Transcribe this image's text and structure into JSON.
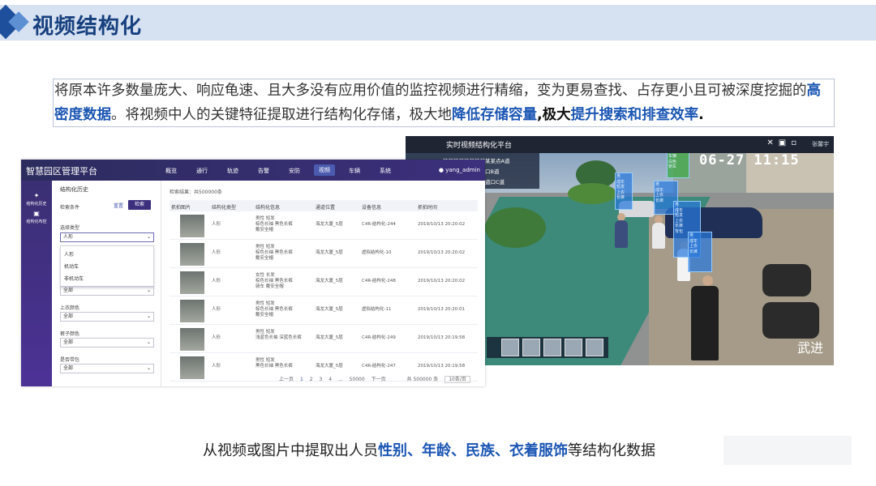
{
  "slide": {
    "title": "视频结构化",
    "paragraph": {
      "p1": "将原本许多数量庞大、响应龟速、且大多没有应用价值的监控视频进行精缩，变为更易查找、占存更小且可被深度挖掘的",
      "hl1": "高密度数据",
      "p2": "。将视频中人的关键特征提取进行结构化存储，",
      "p3": "极大地",
      "hl2": "降低存储容量",
      "p4": ",极大",
      "hl3": "提升搜索和排查效率",
      "p5": "."
    },
    "caption": {
      "prefix": "从视频或图片中提取出人员",
      "h1": "性别",
      "s1": "、",
      "h2": "年龄",
      "s2": "、",
      "h3": "民族",
      "s3": "、",
      "h4": "衣着服饰",
      "suffix": "等结构化数据"
    },
    "accent_color": "#1b56b3",
    "title_color": "#17407f"
  },
  "video_panel": {
    "title": "实时视频结构化平台",
    "user": "张馨宇",
    "timestamp": "06-27 11:15",
    "watermark": "武进",
    "channels": [
      "某某某某某某某某某某点A道",
      "某某某某某某某某口B道",
      "某某某某某某某某道口C道"
    ]
  },
  "app": {
    "title": "智慧园区管理平台",
    "nav": [
      "概览",
      "通行",
      "轨迹",
      "告警",
      "安防",
      "视频",
      "车辆",
      "系统"
    ],
    "active_nav": "视频",
    "user": "yang_admin",
    "sidebar": [
      {
        "label": "结构化历史",
        "icon": "history-icon"
      },
      {
        "label": "结构化布控",
        "icon": "control-icon"
      }
    ],
    "filter": {
      "title": "结构化历史",
      "condition_label": "检索条件",
      "reset_label": "重置",
      "search_label": "检索",
      "type_label": "选择类型",
      "type_value": "人形",
      "type_options": [
        "人形",
        "机动车",
        "非机动车"
      ],
      "hidden_select_value": "全部",
      "top_color_label": "上衣颜色",
      "top_color_value": "全部",
      "pants_color_label": "裤子颜色",
      "pants_color_value": "全部",
      "bag_label": "是否带包",
      "bag_value": "全部"
    },
    "results": {
      "info": "检索结果：共500000条",
      "columns": [
        "抓拍图片",
        "结构化类型",
        "结构化信息",
        "通道位置",
        "设备信息",
        "抓拍时间"
      ],
      "rows": [
        {
          "type": "人形",
          "info": [
            "男性 短发",
            "棕色长袖 黑色长裤",
            "戴安全帽"
          ],
          "location": "海龙大厦_5层",
          "device": "C4R-结构化-244",
          "time": "2019/10/13 20:20:02"
        },
        {
          "type": "人形",
          "info": [
            "男性 短发",
            "棕色长袖 黑色长裤",
            "戴安全帽"
          ],
          "location": "海龙大厦_5层",
          "device": "虚拟结构化-10",
          "time": "2019/10/13 20:20:02"
        },
        {
          "type": "人形",
          "info": [
            "女性 长发",
            "棕色长袖 黑色长裤",
            "骑车 戴安全帽"
          ],
          "location": "海龙大厦_5层",
          "device": "C4R-结构化-248",
          "time": "2019/10/13 20:20:02"
        },
        {
          "type": "人形",
          "info": [
            "男性 短发",
            "棕色长袖 黑色长裤",
            "戴安全帽"
          ],
          "location": "海龙大厦_5层",
          "device": "虚拟结构化-11",
          "time": "2019/10/13 20:20:01"
        },
        {
          "type": "人形",
          "info": [
            "男性 短发",
            "浅蓝色长袖 深蓝色长裤"
          ],
          "location": "海龙大厦_5层",
          "device": "C4R-结构化-249",
          "time": "2019/10/13 20:19:58"
        },
        {
          "type": "人形",
          "info": [
            "男性 短发",
            "黑色长袖 黑色长裤"
          ],
          "location": "海龙大厦_5层",
          "device": "C4R-结构化-247",
          "time": "2019/10/13 20:19:58"
        }
      ]
    },
    "pager": {
      "prev": "上一页",
      "pages": [
        "1",
        "2",
        "3",
        "4",
        "...",
        "50000"
      ],
      "next": "下一页",
      "total": "共 500000 条",
      "page_size": "10条/页"
    }
  }
}
